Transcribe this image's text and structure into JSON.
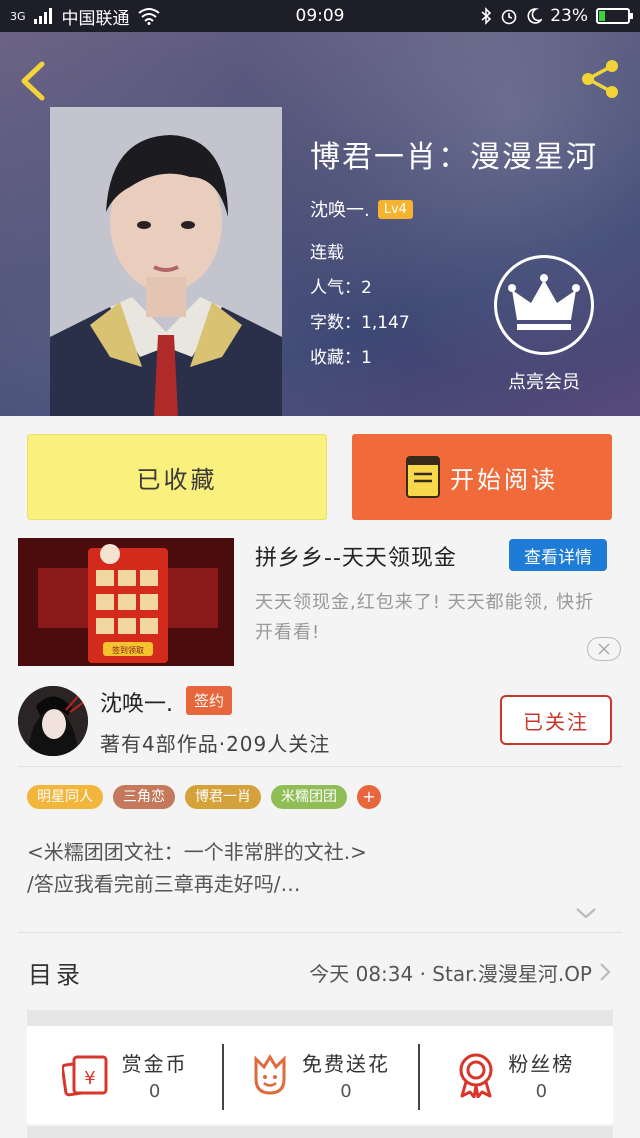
{
  "status_bar": {
    "network": "3G",
    "carrier": "中国联通",
    "time": "09:09",
    "battery": "23%",
    "battery_level": 0.23
  },
  "book": {
    "title": "博君一肖：漫漫星河",
    "author": "沈唤一.",
    "author_level": "Lv4",
    "status": "连载",
    "popularity": "人气：2",
    "word_count": "字数：1,147",
    "favorites": "收藏：1"
  },
  "vip": {
    "label": "点亮会员"
  },
  "actions": {
    "collect_label": "已收藏",
    "read_label": "开始阅读"
  },
  "ad": {
    "title": "拼乡乡--天天领现金",
    "detail_label": "查看详情",
    "description": "天天领现金,红包来了! 天天都能领, 快折开看看!",
    "close_icon": "close-icon",
    "image_caption": "签到领取"
  },
  "author": {
    "name": "沈唤一.",
    "sign_badge": "签约",
    "stats": "著有4部作品·209人关注",
    "follow_label": "已关注"
  },
  "tags": [
    {
      "label": "明星同人",
      "color": "#f3b63c"
    },
    {
      "label": "三角恋",
      "color": "#c5795c"
    },
    {
      "label": "博君一肖",
      "color": "#d4a13a"
    },
    {
      "label": "米糯团团",
      "color": "#8fbd56"
    }
  ],
  "tag_add_label": "+",
  "summary": {
    "line1": "<米糯团团文社：一个非常胖的文社.>",
    "line2": "/答应我看完前三章再走好吗/…"
  },
  "toc": {
    "label": "目录",
    "latest": "今天 08:34 · Star.漫漫星河.OP"
  },
  "rewards": [
    {
      "label": "赏金币",
      "count": "0",
      "icon": "red-envelope-icon"
    },
    {
      "label": "免费送花",
      "count": "0",
      "icon": "flower-icon"
    },
    {
      "label": "粉丝榜",
      "count": "0",
      "icon": "medal-icon"
    }
  ],
  "colors": {
    "accent_orange": "#f06a3a",
    "collect_yellow": "#faf07e",
    "follow_red": "#c8372a",
    "icon_yellow": "#f2d43a"
  }
}
